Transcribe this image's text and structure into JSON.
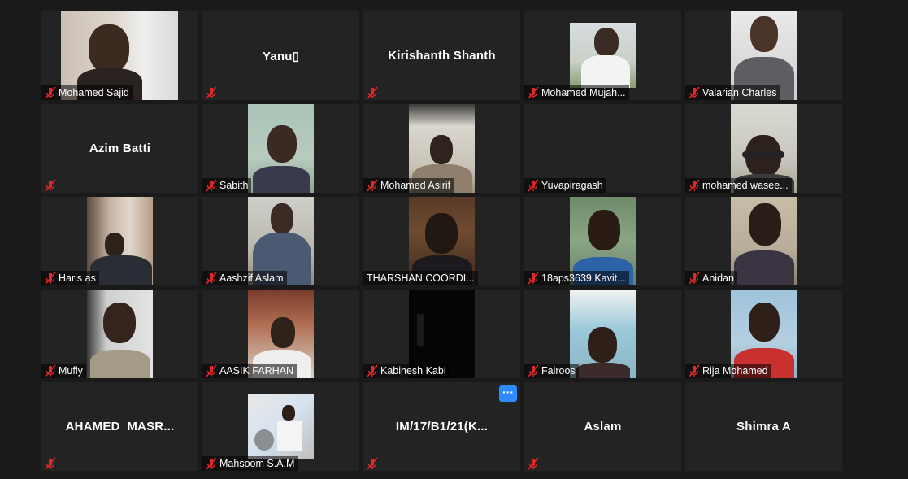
{
  "participants": [
    {
      "name": "Mohamed Sajid",
      "video": true
    },
    {
      "name": "Yanu▯",
      "video": false
    },
    {
      "name": "Kirishanth Shanth",
      "video": false
    },
    {
      "name": "Mohamed Mujah...",
      "video": true
    },
    {
      "name": "Valarian Charles",
      "video": true
    },
    {
      "name": "Azim Batti",
      "video": false
    },
    {
      "name": "Sabith",
      "video": true
    },
    {
      "name": "Mohamed Asirif",
      "video": true
    },
    {
      "name": "Yuvapiragash",
      "video": true
    },
    {
      "name": "mohamed wasee...",
      "video": true
    },
    {
      "name": "Haris as",
      "video": true
    },
    {
      "name": "Aashzif Aslam",
      "video": true
    },
    {
      "name": "THARSHAN COORDI...",
      "video": true
    },
    {
      "name": "18aps3639 Kavit...",
      "video": true
    },
    {
      "name": "Anidan",
      "video": true
    },
    {
      "name": "Mufly",
      "video": true
    },
    {
      "name": "AASIK FARHAN",
      "video": true
    },
    {
      "name": "Kabinesh Kabi",
      "video": true
    },
    {
      "name": "Fairoos",
      "video": true
    },
    {
      "name": "Rija Mohamed",
      "video": true
    },
    {
      "name": "AHAMED  MASR...",
      "video": false
    },
    {
      "name": "Mahsoom S.A.M",
      "video": true
    },
    {
      "name": "IM/17/B1/21(K...",
      "video": false
    },
    {
      "name": "Aslam",
      "video": false
    },
    {
      "name": "Shimra A",
      "video": false
    }
  ],
  "more_button": "···",
  "colors": {
    "background": "#1a1a1a",
    "tile": "#232323",
    "muted_red": "#e02828",
    "accent": "#2d8cff"
  },
  "icons": {
    "muted": "muted-mic-icon"
  }
}
